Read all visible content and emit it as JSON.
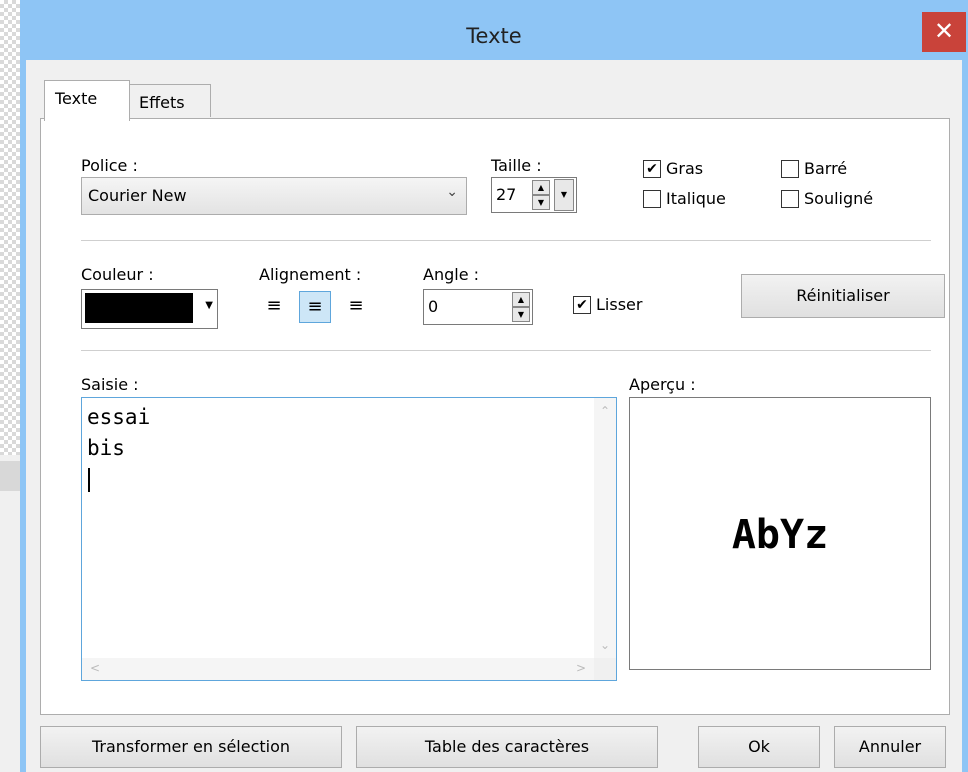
{
  "dialog": {
    "title": "Texte",
    "close_glyph": "✕",
    "tabs": [
      {
        "label": "Texte",
        "active": true
      },
      {
        "label": "Effets",
        "active": false
      }
    ]
  },
  "font": {
    "label": "Police :",
    "value": "Courier New",
    "size_label": "Taille :",
    "size_value": "27"
  },
  "styles": {
    "bold": {
      "label": "Gras",
      "checked": true
    },
    "strike": {
      "label": "Barré",
      "checked": false
    },
    "italic": {
      "label": "Italique",
      "checked": false
    },
    "underline": {
      "label": "Souligné",
      "checked": false
    }
  },
  "color": {
    "label": "Couleur :",
    "value": "#000000"
  },
  "alignment": {
    "label": "Alignement :",
    "selected": "center"
  },
  "angle": {
    "label": "Angle :",
    "value": "0"
  },
  "smooth": {
    "label": "Lisser",
    "checked": true
  },
  "reset_label": "Réinitialiser",
  "input": {
    "label": "Saisie :",
    "value": "essai\nbis\n"
  },
  "preview": {
    "label": "Aperçu :",
    "text": "AbYz"
  },
  "buttons": {
    "transform": "Transformer en sélection",
    "charmap": "Table des caractères",
    "ok": "Ok",
    "cancel": "Annuler"
  },
  "icons": [
    "close-icon",
    "dropdown-arrow-icon",
    "spin-up-icon",
    "spin-down-icon",
    "align-left-icon",
    "align-center-icon",
    "align-right-icon",
    "checkmark-icon"
  ]
}
